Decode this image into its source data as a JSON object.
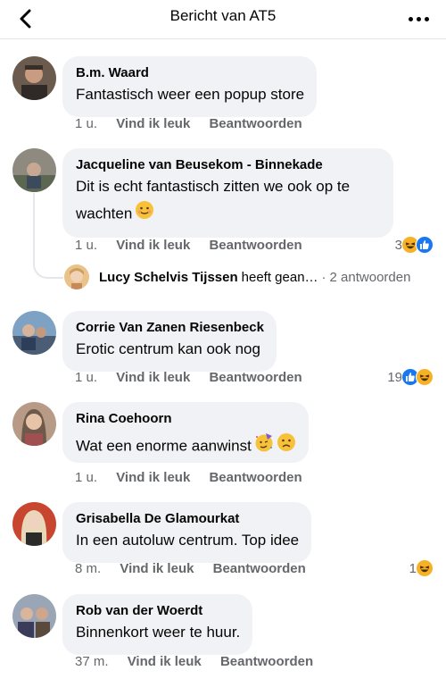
{
  "header": {
    "title": "Bericht van AT5",
    "back_icon": "chevron-left-icon",
    "more_icon": "more-dots-icon"
  },
  "comments": [
    {
      "author": "B.m. Waard",
      "text": "Fantastisch weer een popup store",
      "time": "1 u.",
      "like": "Vind ik leuk",
      "reply": "Beantwoorden"
    },
    {
      "author": "Jacqueline van Beusekom - Binnekade",
      "text_line1": "Dit is echt fantastisch zitten we ook op te",
      "text_line2": "wachten",
      "time": "1 u.",
      "like": "Vind ik leuk",
      "reply": "Beantwoorden",
      "reaction_count": "3",
      "reactions": [
        "haha",
        "like"
      ],
      "text_emoji": "smiling-face-emoji"
    },
    {
      "author": "Corrie Van Zanen Riesenbeck",
      "text": "Erotic centrum kan ook nog",
      "time": "1 u.",
      "like": "Vind ik leuk",
      "reply": "Beantwoorden",
      "reaction_count": "19",
      "reactions": [
        "like",
        "haha"
      ]
    },
    {
      "author": "Rina Coehoorn",
      "text": "Wat een enorme aanwinst",
      "time": "1 u.",
      "like": "Vind ik leuk",
      "reply": "Beantwoorden",
      "text_emojis": [
        "party-face-emoji",
        "sad-face-emoji"
      ]
    },
    {
      "author": "Grisabella De Glamourkat",
      "text": "In een autoluw centrum. Top idee",
      "time": "8 m.",
      "like": "Vind ik leuk",
      "reply": "Beantwoorden",
      "reaction_count": "1",
      "reactions": [
        "haha"
      ]
    },
    {
      "author": "Rob van der Woerdt",
      "text": "Binnenkort weer te huur.",
      "time": "37 m.",
      "like": "Vind ik leuk",
      "reply": "Beantwoorden"
    }
  ],
  "reply_preview": {
    "author": "Lucy Schelvis Tijssen",
    "text": "heeft gean…",
    "separator": "·",
    "count": "2 antwoorden"
  },
  "colors": {
    "bubble": "#f0f2f5",
    "meta": "#65676b",
    "like_blue": "#1877f2",
    "haha_yellow": "#f7b125"
  }
}
